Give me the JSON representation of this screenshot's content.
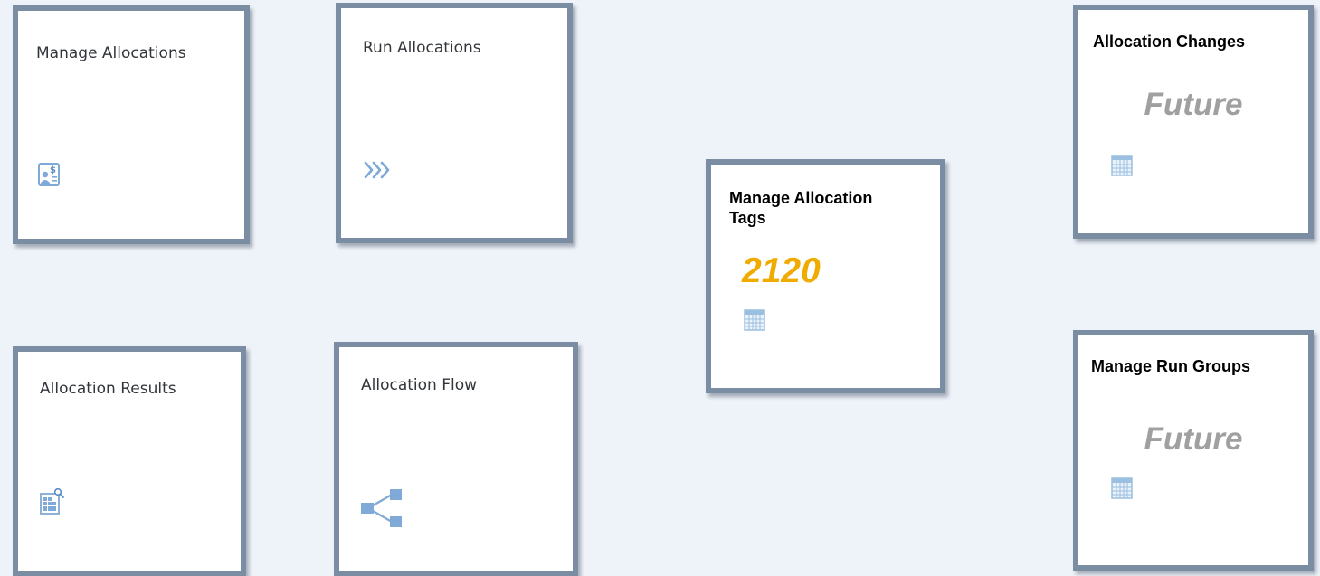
{
  "tiles": {
    "manage_allocations": {
      "title": "Manage Allocations",
      "icon": "financial-document-icon"
    },
    "run_allocations": {
      "title": "Run Allocations",
      "icon": "chevrons-right-icon"
    },
    "allocation_results": {
      "title": "Allocation Results",
      "icon": "report-search-icon"
    },
    "allocation_flow": {
      "title": "Allocation Flow",
      "icon": "flow-tree-icon"
    },
    "manage_allocation_tags": {
      "title_line1": "Manage Allocation",
      "title_line2": "Tags",
      "kpi": "2120",
      "icon": "calendar-icon"
    },
    "allocation_changes": {
      "title": "Allocation Changes",
      "kpi": "Future",
      "icon": "calendar-icon"
    },
    "manage_run_groups": {
      "title": "Manage Run Groups",
      "kpi": "Future",
      "icon": "calendar-icon"
    }
  },
  "colors": {
    "background": "#eef3f9",
    "tile_border": "#7a8da3",
    "icon_blue": "#9bbfe0",
    "kpi_gold": "#f0ab00",
    "kpi_grey": "#a0a0a0"
  }
}
